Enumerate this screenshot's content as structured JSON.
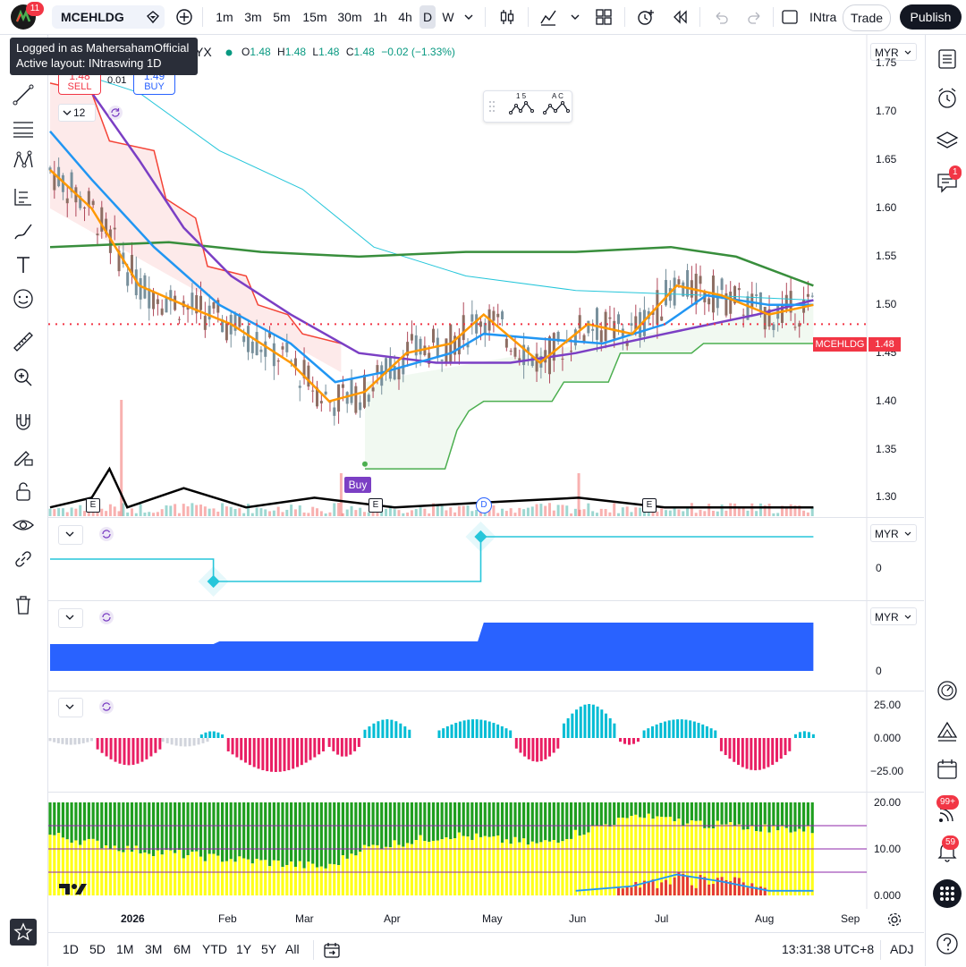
{
  "toolbar": {
    "avatar_badge": "11",
    "symbol": "MCEHLDG",
    "timeframes": [
      "1m",
      "3m",
      "5m",
      "15m",
      "30m",
      "1h",
      "4h",
      "D",
      "W"
    ],
    "active_timeframe": "D",
    "layout_name": "INtra",
    "trade_label": "Trade",
    "publish_label": "Publish"
  },
  "tooltip": {
    "line1": "Logged in as MahersahamOfficial",
    "line2": "Active layout: INtraswing 1D"
  },
  "legend": {
    "exchange_suffix": "YX",
    "open_label": "O",
    "open": "1.48",
    "high_label": "H",
    "high": "1.48",
    "low_label": "L",
    "low": "1.48",
    "close_label": "C",
    "close": "1.48",
    "change": "−0.02 (−1.33%)",
    "sell_price": "1.48",
    "sell_label": "SELL",
    "spread": "0.01",
    "buy_price": "1.49",
    "buy_label": "BUY",
    "indicator_count": "12"
  },
  "drawing_widget": {
    "label1": "1 5",
    "label2": "A C"
  },
  "price_pane": {
    "currency": "MYR",
    "price_labels": [
      "1.75",
      "1.70",
      "1.65",
      "1.60",
      "1.55",
      "1.50",
      "1.45",
      "1.40",
      "1.35",
      "1.30"
    ],
    "current_tag_symbol": "MCEHLDG",
    "current_tag_price": "1.48",
    "buy_marker": "Buy",
    "event_e": "E",
    "event_d": "D"
  },
  "pane2": {
    "currency": "MYR",
    "zero": "0"
  },
  "pane3": {
    "currency": "MYR",
    "zero": "0"
  },
  "pane4": {
    "labels": [
      "25.00",
      "0.000",
      "−25.00"
    ]
  },
  "pane5": {
    "labels": [
      "20.00",
      "10.00",
      "0.000"
    ]
  },
  "date_axis": {
    "labels": [
      "2026",
      "Feb",
      "Mar",
      "Apr",
      "May",
      "Jun",
      "Jul",
      "Aug",
      "Sep"
    ]
  },
  "bottom": {
    "ranges": [
      "1D",
      "5D",
      "1M",
      "3M",
      "6M",
      "YTD",
      "1Y",
      "5Y",
      "All"
    ],
    "clock": "13:31:38 UTC+8",
    "adj": "ADJ"
  },
  "right_badges": {
    "chat": "1",
    "feed": "99+",
    "alerts": "59"
  },
  "colors": {
    "up": "#26a69a",
    "down": "#ef5350",
    "accent": "#2962ff",
    "ema_purple": "#7b3fc4",
    "ema_orange": "#ff9800",
    "sma_green": "#388e3c"
  },
  "chart_data": {
    "type": "candlestick",
    "currency": "MYR",
    "ylim": [
      1.28,
      1.78
    ],
    "x_range": [
      "2025-12-06",
      "2026-08-22"
    ],
    "last_price": 1.48,
    "session_change": -0.02,
    "session_change_pct": -1.33,
    "lines": {
      "red_trailing_stop": [
        {
          "x": "2025-12-06",
          "y": 1.73
        },
        {
          "x": "2025-12-20",
          "y": 1.72
        },
        {
          "x": "2025-12-26",
          "y": 1.67
        },
        {
          "x": "2026-01-10",
          "y": 1.66
        },
        {
          "x": "2026-01-14",
          "y": 1.61
        },
        {
          "x": "2026-01-24",
          "y": 1.59
        },
        {
          "x": "2026-01-28",
          "y": 1.54
        },
        {
          "x": "2026-02-10",
          "y": 1.53
        },
        {
          "x": "2026-02-14",
          "y": 1.5
        },
        {
          "x": "2026-02-24",
          "y": 1.49
        },
        {
          "x": "2026-03-01",
          "y": 1.47
        },
        {
          "x": "2026-03-14",
          "y": 1.46
        }
      ],
      "green_trailing_stop": [
        {
          "x": "2026-03-22",
          "y": 1.33
        },
        {
          "x": "2026-04-18",
          "y": 1.33
        },
        {
          "x": "2026-04-22",
          "y": 1.37
        },
        {
          "x": "2026-04-26",
          "y": 1.39
        },
        {
          "x": "2026-05-01",
          "y": 1.4
        },
        {
          "x": "2026-05-24",
          "y": 1.4
        },
        {
          "x": "2026-05-28",
          "y": 1.42
        },
        {
          "x": "2026-06-12",
          "y": 1.42
        },
        {
          "x": "2026-06-16",
          "y": 1.45
        },
        {
          "x": "2026-07-10",
          "y": 1.45
        },
        {
          "x": "2026-07-14",
          "y": 1.46
        },
        {
          "x": "2026-08-20",
          "y": 1.46
        }
      ],
      "sma_long_green": [
        {
          "x": "2025-12-06",
          "y": 1.56
        },
        {
          "x": "2026-01-15",
          "y": 1.565
        },
        {
          "x": "2026-02-15",
          "y": 1.555
        },
        {
          "x": "2026-03-20",
          "y": 1.55
        },
        {
          "x": "2026-04-25",
          "y": 1.555
        },
        {
          "x": "2026-06-01",
          "y": 1.555
        },
        {
          "x": "2026-07-03",
          "y": 1.56
        },
        {
          "x": "2026-07-25",
          "y": 1.55
        },
        {
          "x": "2026-08-20",
          "y": 1.52
        }
      ],
      "ema_purple": [
        {
          "x": "2025-12-06",
          "y": 1.77
        },
        {
          "x": "2025-12-20",
          "y": 1.72
        },
        {
          "x": "2026-01-05",
          "y": 1.65
        },
        {
          "x": "2026-01-20",
          "y": 1.58
        },
        {
          "x": "2026-02-05",
          "y": 1.53
        },
        {
          "x": "2026-02-25",
          "y": 1.49
        },
        {
          "x": "2026-03-20",
          "y": 1.45
        },
        {
          "x": "2026-04-15",
          "y": 1.44
        },
        {
          "x": "2026-05-10",
          "y": 1.44
        },
        {
          "x": "2026-06-01",
          "y": 1.45
        },
        {
          "x": "2026-07-01",
          "y": 1.47
        },
        {
          "x": "2026-08-01",
          "y": 1.49
        },
        {
          "x": "2026-08-20",
          "y": 1.505
        }
      ],
      "ema_blue": [
        {
          "x": "2025-12-06",
          "y": 1.68
        },
        {
          "x": "2025-12-20",
          "y": 1.63
        },
        {
          "x": "2026-01-10",
          "y": 1.56
        },
        {
          "x": "2026-02-01",
          "y": 1.5
        },
        {
          "x": "2026-02-25",
          "y": 1.46
        },
        {
          "x": "2026-03-12",
          "y": 1.42
        },
        {
          "x": "2026-03-28",
          "y": 1.43
        },
        {
          "x": "2026-04-20",
          "y": 1.45
        },
        {
          "x": "2026-05-01",
          "y": 1.47
        },
        {
          "x": "2026-05-20",
          "y": 1.465
        },
        {
          "x": "2026-06-10",
          "y": 1.46
        },
        {
          "x": "2026-07-01",
          "y": 1.48
        },
        {
          "x": "2026-07-15",
          "y": 1.51
        },
        {
          "x": "2026-08-05",
          "y": 1.5
        },
        {
          "x": "2026-08-20",
          "y": 1.5
        }
      ],
      "ema_orange": [
        {
          "x": "2025-12-06",
          "y": 1.64
        },
        {
          "x": "2025-12-20",
          "y": 1.6
        },
        {
          "x": "2026-01-05",
          "y": 1.52
        },
        {
          "x": "2026-01-20",
          "y": 1.5
        },
        {
          "x": "2026-02-05",
          "y": 1.48
        },
        {
          "x": "2026-02-25",
          "y": 1.44
        },
        {
          "x": "2026-03-10",
          "y": 1.4
        },
        {
          "x": "2026-03-22",
          "y": 1.41
        },
        {
          "x": "2026-04-05",
          "y": 1.45
        },
        {
          "x": "2026-04-20",
          "y": 1.46
        },
        {
          "x": "2026-05-01",
          "y": 1.49
        },
        {
          "x": "2026-05-20",
          "y": 1.44
        },
        {
          "x": "2026-06-05",
          "y": 1.48
        },
        {
          "x": "2026-06-20",
          "y": 1.47
        },
        {
          "x": "2026-07-05",
          "y": 1.52
        },
        {
          "x": "2026-07-20",
          "y": 1.51
        },
        {
          "x": "2026-08-05",
          "y": 1.49
        },
        {
          "x": "2026-08-20",
          "y": 1.5
        }
      ],
      "cyan_band": [
        {
          "x": "2025-12-06",
          "y": 1.75
        },
        {
          "x": "2026-01-05",
          "y": 1.72
        },
        {
          "x": "2026-02-01",
          "y": 1.66
        },
        {
          "x": "2026-03-01",
          "y": 1.62
        },
        {
          "x": "2026-03-25",
          "y": 1.56
        },
        {
          "x": "2026-04-25",
          "y": 1.53
        },
        {
          "x": "2026-06-01",
          "y": 1.515
        },
        {
          "x": "2026-07-15",
          "y": 1.51
        },
        {
          "x": "2026-08-20",
          "y": 1.505
        }
      ],
      "volume_overlay": [
        {
          "x": "2025-12-06",
          "y": 1.29
        },
        {
          "x": "2025-12-20",
          "y": 1.3
        },
        {
          "x": "2025-12-26",
          "y": 1.33
        },
        {
          "x": "2026-01-01",
          "y": 1.29
        },
        {
          "x": "2026-01-20",
          "y": 1.31
        },
        {
          "x": "2026-02-10",
          "y": 1.29
        },
        {
          "x": "2026-03-05",
          "y": 1.3
        },
        {
          "x": "2026-04-01",
          "y": 1.29
        },
        {
          "x": "2026-05-01",
          "y": 1.295
        },
        {
          "x": "2026-06-02",
          "y": 1.3
        },
        {
          "x": "2026-07-01",
          "y": 1.29
        },
        {
          "x": "2026-08-20",
          "y": 1.29
        }
      ]
    },
    "pane2_step": [
      {
        "x": "2025-12-06",
        "y": 1
      },
      {
        "x": "2026-01-30",
        "y": 1
      },
      {
        "x": "2026-01-30",
        "y": 0
      },
      {
        "x": "2026-04-30",
        "y": 0
      },
      {
        "x": "2026-04-30",
        "y": 2
      },
      {
        "x": "2026-08-20",
        "y": 2
      }
    ],
    "pane3_area": [
      {
        "x": "2025-12-06",
        "y": 1
      },
      {
        "x": "2026-01-30",
        "y": 1
      },
      {
        "x": "2026-02-01",
        "y": 1.1
      },
      {
        "x": "2026-04-29",
        "y": 1.1
      },
      {
        "x": "2026-05-01",
        "y": 1.8
      },
      {
        "x": "2026-08-20",
        "y": 1.8
      }
    ],
    "pane4_histogram": {
      "ylim": [
        -40,
        40
      ],
      "segments": [
        {
          "from": "2025-12-06",
          "to": "2025-12-20",
          "peak": -8,
          "color": "#d1d4dc"
        },
        {
          "from": "2025-12-22",
          "to": "2026-01-12",
          "peak": -32,
          "color": "#e91e63"
        },
        {
          "from": "2026-01-13",
          "to": "2026-01-28",
          "peak": -10,
          "color": "#d1d4dc"
        },
        {
          "from": "2026-01-26",
          "to": "2026-02-02",
          "peak": 8,
          "color": "#00bcd4"
        },
        {
          "from": "2026-02-04",
          "to": "2026-03-08",
          "peak": -40,
          "color": "#e91e63"
        },
        {
          "from": "2026-03-10",
          "to": "2026-03-20",
          "peak": -22,
          "color": "#e91e63"
        },
        {
          "from": "2026-03-22",
          "to": "2026-04-06",
          "peak": 22,
          "color": "#00bcd4"
        },
        {
          "from": "2026-04-16",
          "to": "2026-05-10",
          "peak": 22,
          "color": "#00bcd4"
        },
        {
          "from": "2026-05-12",
          "to": "2026-05-26",
          "peak": -28,
          "color": "#e91e63"
        },
        {
          "from": "2026-05-28",
          "to": "2026-06-14",
          "peak": 40,
          "color": "#00bcd4"
        },
        {
          "from": "2026-06-16",
          "to": "2026-06-22",
          "peak": -8,
          "color": "#e91e63"
        },
        {
          "from": "2026-06-24",
          "to": "2026-07-18",
          "peak": 22,
          "color": "#00bcd4"
        },
        {
          "from": "2026-07-20",
          "to": "2026-08-12",
          "peak": -38,
          "color": "#e91e63"
        },
        {
          "from": "2026-08-14",
          "to": "2026-08-20",
          "peak": 8,
          "color": "#00bcd4"
        }
      ]
    },
    "pane5_stacked": {
      "ylim": [
        0,
        20
      ],
      "hlines": [
        15,
        10,
        5
      ],
      "yellow_top": [
        {
          "x": "2025-12-06",
          "y": 13
        },
        {
          "x": "2026-01-01",
          "y": 10
        },
        {
          "x": "2026-02-01",
          "y": 8
        },
        {
          "x": "2026-03-10",
          "y": 6
        },
        {
          "x": "2026-03-20",
          "y": 10
        },
        {
          "x": "2026-04-20",
          "y": 13
        },
        {
          "x": "2026-05-20",
          "y": 11
        },
        {
          "x": "2026-06-20",
          "y": 17
        },
        {
          "x": "2026-07-20",
          "y": 15
        },
        {
          "x": "2026-08-20",
          "y": 14
        }
      ],
      "red_bars_range": [
        "2026-06-15",
        "2026-08-05"
      ],
      "blue_line": [
        {
          "x": "2026-06-01",
          "y": 1
        },
        {
          "x": "2026-06-20",
          "y": 2
        },
        {
          "x": "2026-07-05",
          "y": 4.5
        },
        {
          "x": "2026-07-20",
          "y": 3
        },
        {
          "x": "2026-08-05",
          "y": 1
        },
        {
          "x": "2026-08-20",
          "y": 1
        }
      ]
    }
  }
}
